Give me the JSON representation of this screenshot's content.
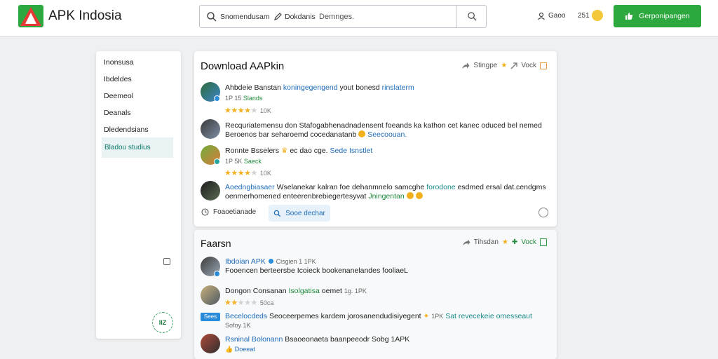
{
  "header": {
    "brand": "APK Indosia",
    "search_scope": "Snomendusam",
    "search_tag": "Dokdanis",
    "search_placeholder": "Demnges.",
    "user_label": "Gaoo",
    "count": "251",
    "cta_label": "Gerponipangen",
    "colors": {
      "brand_red": "#e53935",
      "cta_green": "#2da83f"
    }
  },
  "sidebar": {
    "items": [
      {
        "label": "Inonsusa"
      },
      {
        "label": "Ibdeldes"
      },
      {
        "label": "Deemeol"
      },
      {
        "label": "Deanals"
      },
      {
        "label": "Dledendsians"
      },
      {
        "label": "Bladou studius"
      }
    ],
    "badge": "IIZ"
  },
  "card1": {
    "title": "Download AAPkin",
    "actions": {
      "share_label": "Stingpe",
      "vote_label": "Vock"
    },
    "posts": [
      {
        "line1_name": "Ahbdeie Banstan",
        "line1_text": "koningegengend",
        "line1_rest": "yout bonesd",
        "line1_link": "rinslaterm",
        "meta": "1P 15",
        "meta_tag": "Slands",
        "rating_count": "10K"
      },
      {
        "line1": "Recquriatemensu don Stafogabhenadnadensent foeands ka kathon cet kanec oduced bel nemed",
        "line2": "Beroenos bar seharoemd cocedanatanb",
        "line2_link": "Seecoouan."
      },
      {
        "line1_name": "Ronnte Bsselers",
        "line1_text": "ec dao cge.",
        "line1_link": "Sede Isnstlet",
        "meta": "1P 5K",
        "meta_tag": "Saeck",
        "rating_count": "10K"
      },
      {
        "line1_name": "Aoedngbiasaer",
        "line1_text": "Wselanekar kalran foe dehanmnelo samcghe",
        "line1_link": "forodone",
        "line1_rest": "esdmed ersal dat.cendgms",
        "line2": "oenmerhomened enteerenbrebiegertesyvat",
        "line2_link": "Jningentan"
      }
    ],
    "footer_left": "Foaoetianade",
    "source_label": "Sooe dechar"
  },
  "card2": {
    "title": "Faarsn",
    "actions": {
      "share_label": "Tihsdan",
      "vote_label": "Vock"
    },
    "posts": [
      {
        "name": "Ibdoian APK",
        "meta": "Cisgien 1 1PK",
        "line2": "Fooencen berteersbe Icoieck bookenanelandes fooliaeL"
      },
      {
        "name": "Dongon Consanan",
        "tag": "Isolgatisa",
        "text": "oemet",
        "meta": "1g. 1PK",
        "rating_count": "50ca"
      },
      {
        "tag": "Sees",
        "name": "Becelocdeds",
        "text": "Seoceerpemes kardem jorosanendudisiyegent",
        "meta": "1PK",
        "link": "Sat revecekeie omesseaut",
        "meta2": "Sofoy 1K"
      },
      {
        "name": "Rsninal Bolonann",
        "text": "Bsaoeonaeta baanpeeodr Sobg 1APK",
        "link": "Doeeat"
      }
    ]
  }
}
